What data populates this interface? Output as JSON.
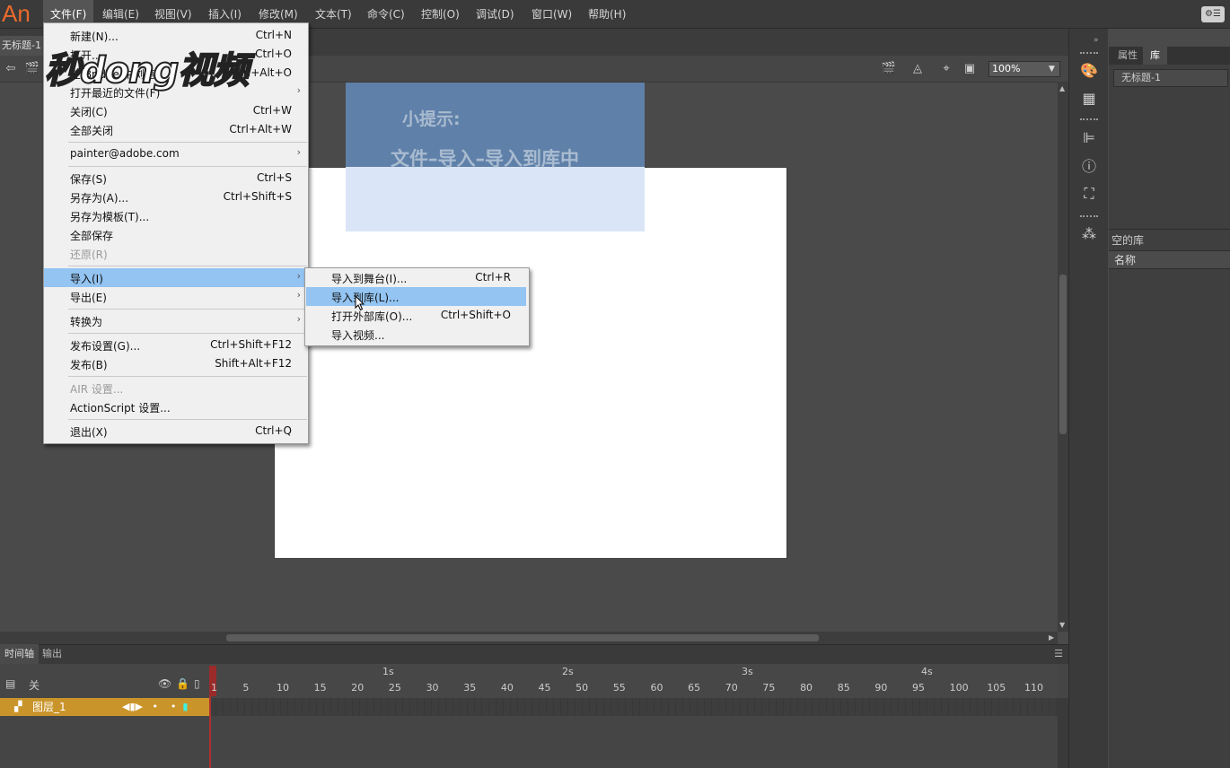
{
  "app": {
    "logo": "An",
    "window_control": "⚙☰"
  },
  "menubar": {
    "items": [
      "文件(F)",
      "编辑(E)",
      "视图(V)",
      "插入(I)",
      "修改(M)",
      "文本(T)",
      "命令(C)",
      "控制(O)",
      "调试(D)",
      "窗口(W)",
      "帮助(H)"
    ]
  },
  "document_tab": "无标题-1",
  "editbar": {
    "zoom": "100%"
  },
  "hint": {
    "line1": "小提示:",
    "line2": "文件–导入–导入到库中"
  },
  "watermark": {
    "text": "秒dong视频"
  },
  "file_menu": {
    "items": [
      {
        "label": "新建(N)...",
        "shortcut": "Ctrl+N"
      },
      {
        "label": "打开...",
        "shortcut": "Ctrl+O"
      },
      {
        "label": "在 Bridge 中浏览",
        "shortcut": "Ctrl+Alt+O"
      },
      {
        "label": "打开最近的文件(F)",
        "shortcut": ""
      },
      {
        "label": "关闭(C)",
        "shortcut": "Ctrl+W"
      },
      {
        "label": "全部关闭",
        "shortcut": "Ctrl+Alt+W"
      },
      {
        "label": "painter@adobe.com",
        "shortcut": ""
      },
      {
        "label": "保存(S)",
        "shortcut": "Ctrl+S"
      },
      {
        "label": "另存为(A)...",
        "shortcut": "Ctrl+Shift+S"
      },
      {
        "label": "另存为模板(T)...",
        "shortcut": ""
      },
      {
        "label": "全部保存",
        "shortcut": ""
      },
      {
        "label": "还原(R)",
        "shortcut": ""
      },
      {
        "label": "导入(I)",
        "shortcut": ""
      },
      {
        "label": "导出(E)",
        "shortcut": ""
      },
      {
        "label": "转换为",
        "shortcut": ""
      },
      {
        "label": "发布设置(G)...",
        "shortcut": "Ctrl+Shift+F12"
      },
      {
        "label": "发布(B)",
        "shortcut": "Shift+Alt+F12"
      },
      {
        "label": "AIR 设置...",
        "shortcut": ""
      },
      {
        "label": "ActionScript 设置...",
        "shortcut": ""
      },
      {
        "label": "退出(X)",
        "shortcut": "Ctrl+Q"
      }
    ]
  },
  "import_submenu": {
    "items": [
      {
        "label": "导入到舞台(I)...",
        "shortcut": "Ctrl+R"
      },
      {
        "label": "导入到库(L)...",
        "shortcut": ""
      },
      {
        "label": "打开外部库(O)...",
        "shortcut": "Ctrl+Shift+O"
      },
      {
        "label": "导入视频...",
        "shortcut": ""
      }
    ]
  },
  "library_panel": {
    "tabs": [
      "属性",
      "库"
    ],
    "document": "无标题-1",
    "empty_text": "空的库",
    "column_name": "名称"
  },
  "timeline": {
    "tabs": [
      "时间轴",
      "输出"
    ],
    "header_label": "关",
    "layer_name": "图层_1",
    "seconds": [
      "1s",
      "2s",
      "3s",
      "4s"
    ],
    "frame_numbers": [
      "1",
      "5",
      "10",
      "15",
      "20",
      "25",
      "30",
      "35",
      "40",
      "45",
      "50",
      "55",
      "60",
      "65",
      "70",
      "75",
      "80",
      "85",
      "90",
      "95",
      "100",
      "105",
      "110"
    ]
  },
  "colors": {
    "accent_select": "#93c4f2",
    "layer_active": "#c9952a",
    "playhead": "#b03030"
  }
}
